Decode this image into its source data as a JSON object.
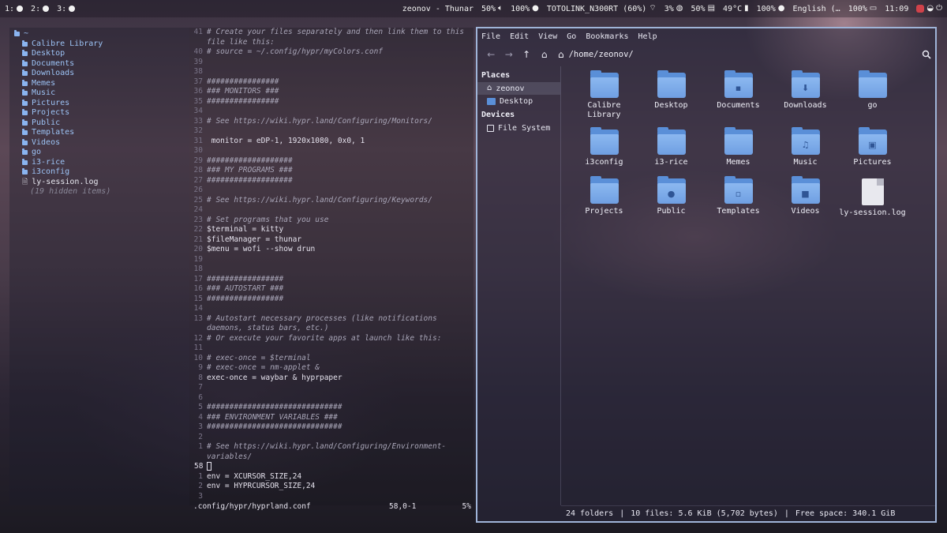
{
  "topbar": {
    "workspaces": [
      {
        "label": "1:"
      },
      {
        "label": "2:"
      },
      {
        "label": "3:"
      }
    ],
    "window_title": "zeonov - Thunar",
    "volume": "50%",
    "mic": "100%",
    "wifi_name": "TOTOLINK_N300RT (60%)",
    "cpu": "3%",
    "memory": "50%",
    "temperature": "49°C",
    "battery": "100%",
    "keyboard_layout": "English (…",
    "brightness": "100%",
    "clock": "11:09"
  },
  "tree": {
    "root": "~",
    "items": [
      {
        "name": "Calibre Library",
        "type": "folder"
      },
      {
        "name": "Desktop",
        "type": "folder"
      },
      {
        "name": "Documents",
        "type": "folder"
      },
      {
        "name": "Downloads",
        "type": "folder"
      },
      {
        "name": "Memes",
        "type": "folder"
      },
      {
        "name": "Music",
        "type": "folder"
      },
      {
        "name": "Pictures",
        "type": "folder"
      },
      {
        "name": "Projects",
        "type": "folder"
      },
      {
        "name": "Public",
        "type": "folder"
      },
      {
        "name": "Templates",
        "type": "folder"
      },
      {
        "name": "Videos",
        "type": "folder"
      },
      {
        "name": "go",
        "type": "folder"
      },
      {
        "name": "i3-rice",
        "type": "folder"
      },
      {
        "name": "i3config",
        "type": "folder"
      },
      {
        "name": "ly-session.log",
        "type": "file"
      }
    ],
    "hidden_note": "(19 hidden items)"
  },
  "editor": {
    "lines": [
      {
        "num": "41",
        "text": "# Create your files separately and then link them to this file like this:",
        "kind": "comment",
        "tall": true
      },
      {
        "num": "40",
        "text": "# source = ~/.config/hypr/myColors.conf",
        "kind": "comment"
      },
      {
        "num": "39",
        "text": "",
        "kind": "plain"
      },
      {
        "num": "38",
        "text": "",
        "kind": "plain"
      },
      {
        "num": "37",
        "text": "################",
        "kind": "comment"
      },
      {
        "num": "36",
        "text": "### MONITORS ###",
        "kind": "comment"
      },
      {
        "num": "35",
        "text": "################",
        "kind": "comment"
      },
      {
        "num": "34",
        "text": "",
        "kind": "plain"
      },
      {
        "num": "33",
        "text": "# See https://wiki.hypr.land/Configuring/Monitors/",
        "kind": "comment"
      },
      {
        "num": "32",
        "text": "",
        "kind": "plain"
      },
      {
        "num": "31",
        "text": " monitor = eDP-1, 1920x1080, 0x0, 1",
        "kind": "plain"
      },
      {
        "num": "30",
        "text": "",
        "kind": "plain"
      },
      {
        "num": "29",
        "text": "###################",
        "kind": "comment"
      },
      {
        "num": "28",
        "text": "### MY PROGRAMS ###",
        "kind": "comment"
      },
      {
        "num": "27",
        "text": "###################",
        "kind": "comment"
      },
      {
        "num": "26",
        "text": "",
        "kind": "plain"
      },
      {
        "num": "25",
        "text": "# See https://wiki.hypr.land/Configuring/Keywords/",
        "kind": "comment"
      },
      {
        "num": "24",
        "text": "",
        "kind": "plain"
      },
      {
        "num": "23",
        "text": "# Set programs that you use",
        "kind": "comment"
      },
      {
        "num": "22",
        "text": "$terminal = kitty",
        "kind": "plain"
      },
      {
        "num": "21",
        "text": "$fileManager = thunar",
        "kind": "plain"
      },
      {
        "num": "20",
        "text": "$menu = wofi --show drun",
        "kind": "plain"
      },
      {
        "num": "19",
        "text": "",
        "kind": "plain"
      },
      {
        "num": "18",
        "text": "",
        "kind": "plain"
      },
      {
        "num": "17",
        "text": "#################",
        "kind": "comment"
      },
      {
        "num": "16",
        "text": "### AUTOSTART ###",
        "kind": "comment"
      },
      {
        "num": "15",
        "text": "#################",
        "kind": "comment"
      },
      {
        "num": "14",
        "text": "",
        "kind": "plain"
      },
      {
        "num": "13",
        "text": "# Autostart necessary processes (like notifications daemons, status bars, etc.)",
        "kind": "comment",
        "tall": true
      },
      {
        "num": "12",
        "text": "# Or execute your favorite apps at launch like this:",
        "kind": "comment"
      },
      {
        "num": "11",
        "text": "",
        "kind": "plain"
      },
      {
        "num": "10",
        "text": "# exec-once = $terminal",
        "kind": "comment"
      },
      {
        "num": "9",
        "text": "# exec-once = nm-applet &",
        "kind": "comment"
      },
      {
        "num": "8",
        "text": "exec-once = waybar & hyprpaper",
        "kind": "plain"
      },
      {
        "num": "7",
        "text": "",
        "kind": "plain"
      },
      {
        "num": "6",
        "text": "",
        "kind": "plain"
      },
      {
        "num": "5",
        "text": "##############################",
        "kind": "comment"
      },
      {
        "num": "4",
        "text": "### ENVIRONMENT VARIABLES ###",
        "kind": "comment"
      },
      {
        "num": "3",
        "text": "##############################",
        "kind": "comment"
      },
      {
        "num": "2",
        "text": "",
        "kind": "plain"
      },
      {
        "num": "1",
        "text": "# See https://wiki.hypr.land/Configuring/Environment-variables/",
        "kind": "comment",
        "tall": true
      },
      {
        "num": "58",
        "text": "",
        "kind": "cursor",
        "current": true
      },
      {
        "num": "1",
        "text": "env = XCURSOR_SIZE,24",
        "kind": "plain"
      },
      {
        "num": "2",
        "text": "env = HYPRCURSOR_SIZE,24",
        "kind": "plain"
      },
      {
        "num": "3",
        "text": "",
        "kind": "plain"
      }
    ],
    "status_file": ".config/hypr/hyprland.conf",
    "status_pos": "58,0-1",
    "status_pct": "5%"
  },
  "thunar": {
    "menu": [
      "File",
      "Edit",
      "View",
      "Go",
      "Bookmarks",
      "Help"
    ],
    "path": "/home/zeonov/",
    "places_header": "Places",
    "places": [
      {
        "label": "zeonov",
        "icon": "home-icon",
        "selected": true
      },
      {
        "label": "Desktop",
        "icon": "desktop-icon",
        "selected": false
      }
    ],
    "devices_header": "Devices",
    "devices": [
      {
        "label": "File System",
        "icon": "drive-icon"
      }
    ],
    "items": [
      {
        "label": "Calibre Library",
        "icon": "folder",
        "emblem": ""
      },
      {
        "label": "Desktop",
        "icon": "folder",
        "emblem": ""
      },
      {
        "label": "Documents",
        "icon": "folder",
        "emblem": "▪"
      },
      {
        "label": "Downloads",
        "icon": "folder",
        "emblem": "⬇"
      },
      {
        "label": "go",
        "icon": "folder",
        "emblem": ""
      },
      {
        "label": "i3config",
        "icon": "folder",
        "emblem": ""
      },
      {
        "label": "i3-rice",
        "icon": "folder",
        "emblem": ""
      },
      {
        "label": "Memes",
        "icon": "folder",
        "emblem": ""
      },
      {
        "label": "Music",
        "icon": "folder",
        "emblem": "♫"
      },
      {
        "label": "Pictures",
        "icon": "folder",
        "emblem": "▣"
      },
      {
        "label": "Projects",
        "icon": "folder",
        "emblem": ""
      },
      {
        "label": "Public",
        "icon": "folder",
        "emblem": "●"
      },
      {
        "label": "Templates",
        "icon": "folder",
        "emblem": "▫"
      },
      {
        "label": "Videos",
        "icon": "folder",
        "emblem": "■"
      },
      {
        "label": "ly-session.log",
        "icon": "file",
        "emblem": ""
      }
    ],
    "status_folders": "24 folders",
    "status_files": "10 files: 5.6 KiB (5,702 bytes)",
    "status_free": "Free space: 340.1 GiB",
    "separator": "|"
  }
}
